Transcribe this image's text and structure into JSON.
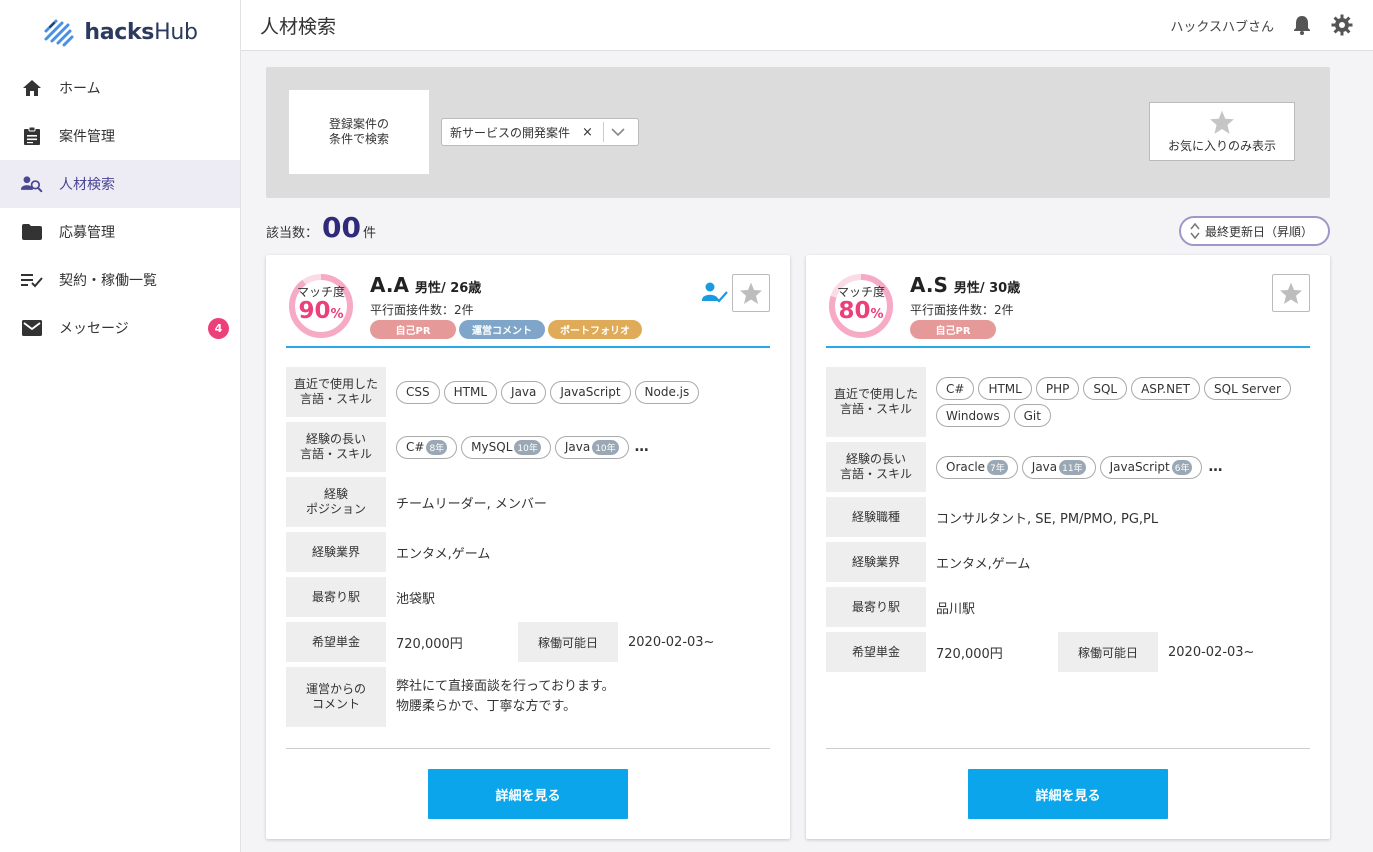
{
  "app": {
    "logo_text_bold": "hacks",
    "logo_text": "Hub"
  },
  "sidebar": {
    "items": [
      {
        "label": "ホーム",
        "icon": "home-icon"
      },
      {
        "label": "案件管理",
        "icon": "clipboard-icon"
      },
      {
        "label": "人材検索",
        "icon": "person-search-icon",
        "active": true
      },
      {
        "label": "応募管理",
        "icon": "folder-icon"
      },
      {
        "label": "契約・稼働一覧",
        "icon": "list-check-icon"
      },
      {
        "label": "メッセージ",
        "icon": "mail-icon",
        "badge": "4"
      }
    ]
  },
  "header": {
    "title": "人材検索",
    "user_name": "ハックスハブさん"
  },
  "search": {
    "label_line1": "登録案件の",
    "label_line2": "条件で検索",
    "selected_project": "新サービスの開発案件",
    "clear": "×",
    "favorite_label": "お気に入りのみ表示"
  },
  "results": {
    "count_label": "該当数：",
    "count": "00",
    "count_unit": "件",
    "sort_label": "最終更新日（昇順）"
  },
  "colors": {
    "accent": "#0aa5ea",
    "match": "#ec407a",
    "active_nav": "#4a4595"
  },
  "cards": [
    {
      "match_label": "マッチ度",
      "match_value": "90",
      "match_fraction": 0.9,
      "pct": "%",
      "initials": "A.A",
      "meta": "男性/ 26歳",
      "parallel": "平行面接件数：2件",
      "tags": [
        "自己PR",
        "運営コメント",
        "ポートフォリオ"
      ],
      "verified": true,
      "rows": {
        "recent_label_1": "直近で使用した",
        "recent_label_2": "言語・スキル",
        "recent_skills": [
          "CSS",
          "HTML",
          "Java",
          "JavaScript",
          "Node.js"
        ],
        "long_label_1": "経験の長い",
        "long_label_2": "言語・スキル",
        "long_skills": [
          {
            "name": "C#",
            "years": "8年"
          },
          {
            "name": "MySQL",
            "years": "10年"
          },
          {
            "name": "Java",
            "years": "10年"
          }
        ],
        "more": "…",
        "position_label_1": "経験",
        "position_label_2": "ポジション",
        "position_value": "チームリーダー, メンバー",
        "industry_label": "経験業界",
        "industry_value": "エンタメ,ゲーム",
        "station_label": "最寄り駅",
        "station_value": "池袋駅",
        "price_label": "希望単金",
        "price_value": "720,000円",
        "start_label": "稼働可能日",
        "start_value": "2020-02-03~",
        "comment_label_1": "運営からの",
        "comment_label_2": "コメント",
        "comment_line1": "弊社にて直接面談を行っております。",
        "comment_line2": "物腰柔らかで、丁寧な方です。"
      },
      "detail_button": "詳細を見る"
    },
    {
      "match_label": "マッチ度",
      "match_value": "80",
      "match_fraction": 0.8,
      "pct": "%",
      "initials": "A.S",
      "meta": "男性/ 30歳",
      "parallel": "平行面接件数：2件",
      "tags": [
        "自己PR"
      ],
      "verified": false,
      "rows": {
        "recent_label_1": "直近で使用した",
        "recent_label_2": "言語・スキル",
        "recent_skills": [
          "C#",
          "HTML",
          "PHP",
          "SQL",
          "ASP.NET",
          "SQL Server",
          "Windows",
          "Git"
        ],
        "long_label_1": "経験の長い",
        "long_label_2": "言語・スキル",
        "long_skills": [
          {
            "name": "Oracle",
            "years": "7年"
          },
          {
            "name": "Java",
            "years": "11年"
          },
          {
            "name": "JavaScript",
            "years": "6年"
          }
        ],
        "more": "…",
        "role_label": "経験職種",
        "role_value": "コンサルタント, SE, PM/PMO, PG,PL",
        "industry_label": "経験業界",
        "industry_value": "エンタメ,ゲーム",
        "station_label": "最寄り駅",
        "station_value": "品川駅",
        "price_label": "希望単金",
        "price_value": "720,000円",
        "start_label": "稼働可能日",
        "start_value": "2020-02-03~"
      },
      "detail_button": "詳細を見る"
    }
  ]
}
